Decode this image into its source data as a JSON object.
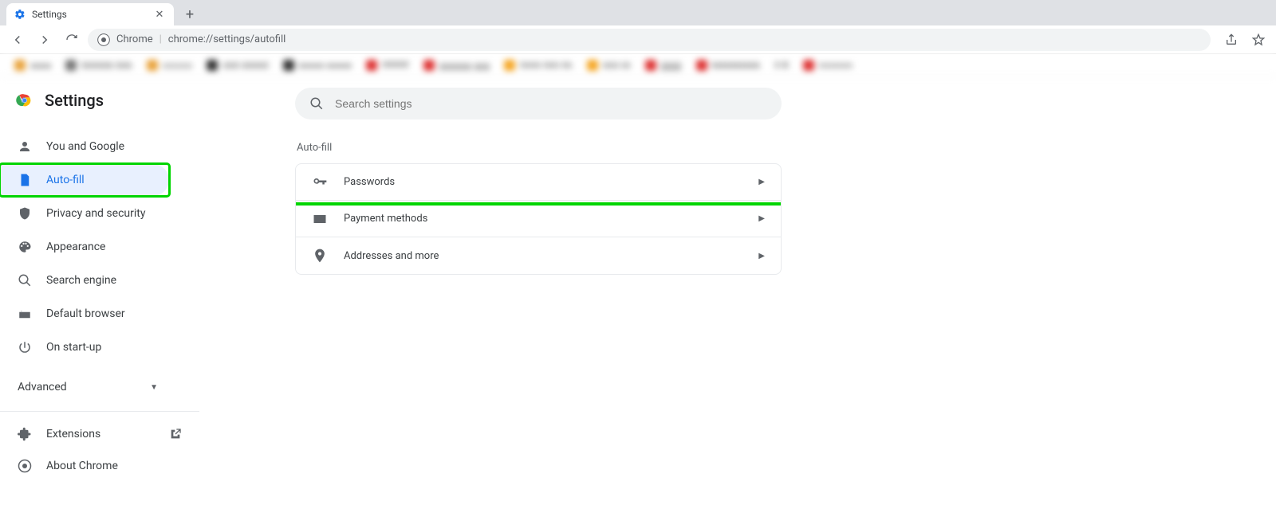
{
  "tab": {
    "title": "Settings"
  },
  "omnibox": {
    "chrome_label": "Chrome",
    "url": "chrome://settings/autofill"
  },
  "page": {
    "title": "Settings",
    "search_placeholder": "Search settings",
    "section_title": "Auto-fill"
  },
  "sidebar": {
    "items": [
      {
        "label": "You and Google"
      },
      {
        "label": "Auto-fill"
      },
      {
        "label": "Privacy and security"
      },
      {
        "label": "Appearance"
      },
      {
        "label": "Search engine"
      },
      {
        "label": "Default browser"
      },
      {
        "label": "On start-up"
      }
    ],
    "advanced": "Advanced",
    "extensions": "Extensions",
    "about": "About Chrome"
  },
  "rows": [
    {
      "label": "Passwords"
    },
    {
      "label": "Payment methods"
    },
    {
      "label": "Addresses and more"
    }
  ]
}
